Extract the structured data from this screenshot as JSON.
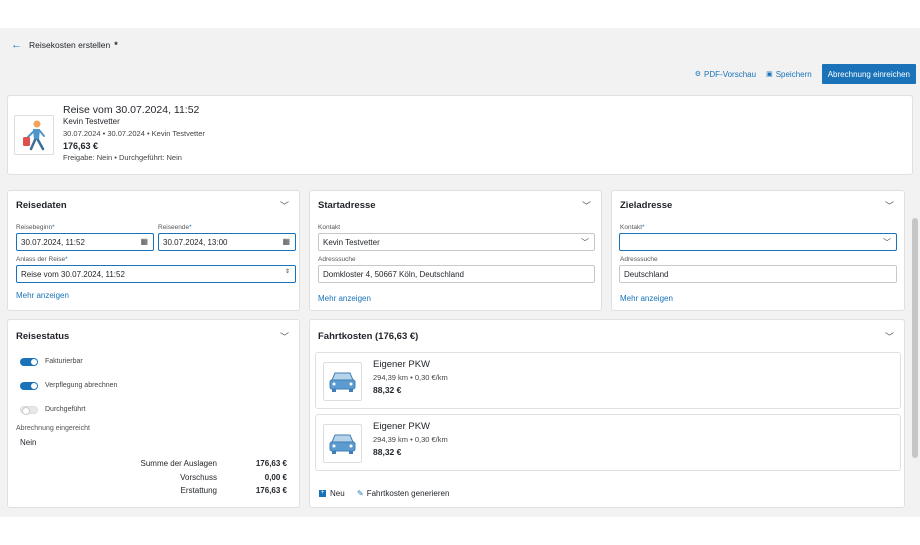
{
  "header": {
    "back_icon": "arrow-left-icon",
    "title": "Reisekosten erstellen",
    "dirty_mark": "*"
  },
  "actions": {
    "pdf": "PDF-Vorschau",
    "save": "Speichern",
    "submit": "Abrechnung einreichen"
  },
  "summary": {
    "title": "Reise vom 30.07.2024, 11:52",
    "name": "Kevin Testvetter",
    "meta": "30.07.2024 • 30.07.2024 • Kevin Testvetter",
    "amount": "176,63 €",
    "status": "Freigabe: Nein • Durchgeführt: Nein"
  },
  "reisedaten": {
    "title": "Reisedaten",
    "start_label": "Reisebeginn",
    "start_value": "30.07.2024, 11:52",
    "end_label": "Reiseende",
    "end_value": "30.07.2024, 13:00",
    "reason_label": "Anlass der Reise",
    "reason_value": "Reise vom 30.07.2024, 11:52",
    "more": "Mehr anzeigen",
    "required_mark": "*"
  },
  "startadresse": {
    "title": "Startadresse",
    "contact_label": "Kontakt",
    "contact_value": "Kevin Testvetter",
    "search_label": "Adresssuche",
    "search_value": "Domkloster 4, 50667 Köln, Deutschland",
    "more": "Mehr anzeigen"
  },
  "zieladresse": {
    "title": "Zieladresse",
    "contact_label": "Kontakt",
    "contact_value": "",
    "search_label": "Adresssuche",
    "search_value": "Deutschland",
    "more": "Mehr anzeigen",
    "required_mark": "*"
  },
  "reisestatus": {
    "title": "Reisestatus",
    "toggles": [
      {
        "label": "Fakturierbar",
        "on": true
      },
      {
        "label": "Verpflegung abrechnen",
        "on": true
      },
      {
        "label": "Durchgeführt",
        "on": false
      }
    ],
    "submitted_label": "Abrechnung eingereicht",
    "submitted_value": "Nein",
    "sums": [
      {
        "label": "Summe der Auslagen",
        "value": "176,63 €"
      },
      {
        "label": "Vorschuss",
        "value": "0,00 €"
      },
      {
        "label": "Erstattung",
        "value": "176,63 €"
      }
    ]
  },
  "fahrtkosten": {
    "title": "Fahrtkosten (176,63 €)",
    "items": [
      {
        "title": "Eigener PKW",
        "meta": "294,39 km • 0,30 €/km",
        "amount": "88,32 €"
      },
      {
        "title": "Eigener PKW",
        "meta": "294,39 km • 0,30 €/km",
        "amount": "88,32 €"
      }
    ],
    "new_label": "Neu",
    "generate_label": "Fahrtkosten generieren"
  },
  "colors": {
    "accent": "#1a73b8",
    "background": "#f2f2f2"
  }
}
